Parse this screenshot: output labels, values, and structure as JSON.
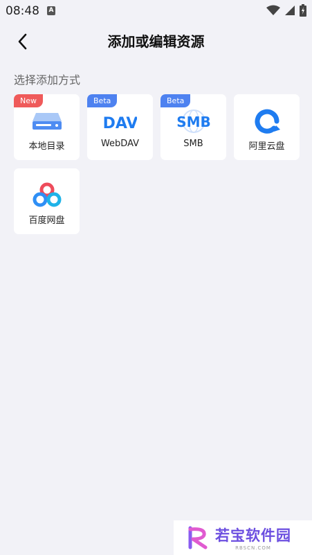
{
  "status_bar": {
    "time": "08:48",
    "notification_icon": "A",
    "icons": [
      "wifi-icon",
      "signal-icon",
      "battery-icon"
    ]
  },
  "header": {
    "back_icon": "chevron-left-icon",
    "title": "添加或编辑资源"
  },
  "section": {
    "label": "选择添加方式"
  },
  "sources": [
    {
      "label": "本地目录",
      "badge": "New",
      "badge_color": "#ef5a5a",
      "icon": "hard-drive-icon"
    },
    {
      "label": "WebDAV",
      "badge": "Beta",
      "badge_color": "#4e82f0",
      "icon": "dav-icon",
      "icon_text": "DAV"
    },
    {
      "label": "SMB",
      "badge": "Beta",
      "badge_color": "#4e82f0",
      "icon": "smb-icon",
      "icon_text": "SMB"
    },
    {
      "label": "阿里云盘",
      "badge": "",
      "icon": "aliyun-drive-icon"
    },
    {
      "label": "百度网盘",
      "badge": "",
      "icon": "baidu-netdisk-icon"
    }
  ],
  "watermark": {
    "name": "若宝软件园",
    "url": "RBSCN.COM"
  },
  "colors": {
    "background": "#f2f2f7",
    "card": "#ffffff",
    "accent_blue": "#1f7cf0",
    "new_badge": "#ef5a5a",
    "beta_badge": "#4e82f0"
  }
}
